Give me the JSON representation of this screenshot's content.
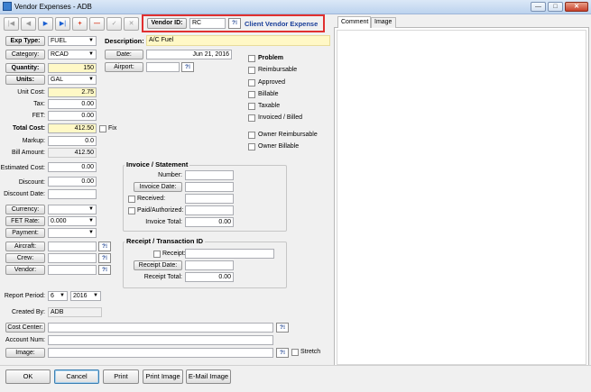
{
  "window": {
    "title": "Vendor Expenses - ADB",
    "minimize": "—",
    "maximize": "□",
    "close": "✕"
  },
  "nav": {
    "first": "|◀",
    "prev": "◀",
    "next": "▶",
    "last": "▶|",
    "add": "+",
    "delete": "—",
    "edit": "✓",
    "cancel": "✕"
  },
  "vendor": {
    "button": "Vendor ID:",
    "value": "RC",
    "lookup": "?⁝",
    "name": "Client Vendor Expense"
  },
  "form": {
    "exp_type_label": "Exp Type:",
    "exp_type_value": "FUEL",
    "category_label": "Category:",
    "category_value": "RCAD",
    "quantity_label": "Quantity:",
    "quantity_value": "150",
    "units_label": "Units:",
    "units_value": "GAL",
    "unit_cost_label": "Unit Cost:",
    "unit_cost_value": "2.75",
    "tax_label": "Tax:",
    "tax_value": "0.00",
    "fet_label": "FET:",
    "fet_value": "0.00",
    "total_cost_label": "Total Cost:",
    "total_cost_value": "412.50",
    "fix_label": "Fix",
    "markup_label": "Markup:",
    "markup_value": "0.0",
    "bill_amount_label": "Bill Amount:",
    "bill_amount_value": "412.50",
    "estimated_cost_label": "Estimated Cost:",
    "estimated_cost_value": "0.00",
    "discount_label": "Discount:",
    "discount_value": "0.00",
    "discount_date_label": "Discount Date:",
    "discount_date_value": "",
    "currency_label": "Currency:",
    "currency_value": "",
    "fet_rate_label": "FET Rate:",
    "fet_rate_value": "0.000",
    "payment_label": "Payment:",
    "payment_value": "",
    "aircraft_label": "Aircraft:",
    "aircraft_value": "",
    "crew_label": "Crew:",
    "crew_value": "",
    "vendor_label": "Vendor:",
    "vendor_value": "",
    "report_period_label": "Report Period:",
    "report_month": "6",
    "report_year": "2016",
    "created_by_label": "Created By:",
    "created_by_value": "ADB",
    "cost_center_label": "Cost Center:",
    "cost_center_value": "",
    "account_num_label": "Account Num:",
    "account_num_value": "",
    "image_label": "Image:",
    "image_value": "",
    "stretch_label": "Stretch",
    "description_label": "Description:",
    "description_value": "A/C Fuel",
    "date_label": "Date:",
    "date_value": "Jun 21, 2016",
    "airport_label": "Airport:",
    "airport_value": ""
  },
  "checks": [
    "Problem",
    "Reimbursable",
    "Approved",
    "Billable",
    "Taxable",
    "Invoiced / Billed",
    "Owner Reimbursable",
    "Owner Billable"
  ],
  "invoice": {
    "title": "Invoice / Statement",
    "number_label": "Number:",
    "number_value": "",
    "invoice_date_label": "Invoice Date:",
    "invoice_date_value": "",
    "received_label": "Received:",
    "received_value": "",
    "paid_label": "Paid/Authorized:",
    "paid_value": "",
    "total_label": "Invoice Total:",
    "total_value": "0.00"
  },
  "receipt": {
    "title": "Receipt / Transaction ID",
    "receipt_label": "Receipt:",
    "receipt_value": "",
    "receipt_date_label": "Receipt Date:",
    "receipt_date_value": "",
    "total_label": "Receipt Total:",
    "total_value": "0.00"
  },
  "tabs": {
    "comment": "Comment",
    "image": "Image"
  },
  "buttons": {
    "ok": "OK",
    "cancel": "Cancel",
    "print": "Print",
    "print_image": "Print Image",
    "email_image": "E-Mail Image"
  },
  "colors": {
    "highlight_field": "#fff8c6",
    "vendor_name": "#1a3f9a",
    "focus_box": "#e03030"
  }
}
